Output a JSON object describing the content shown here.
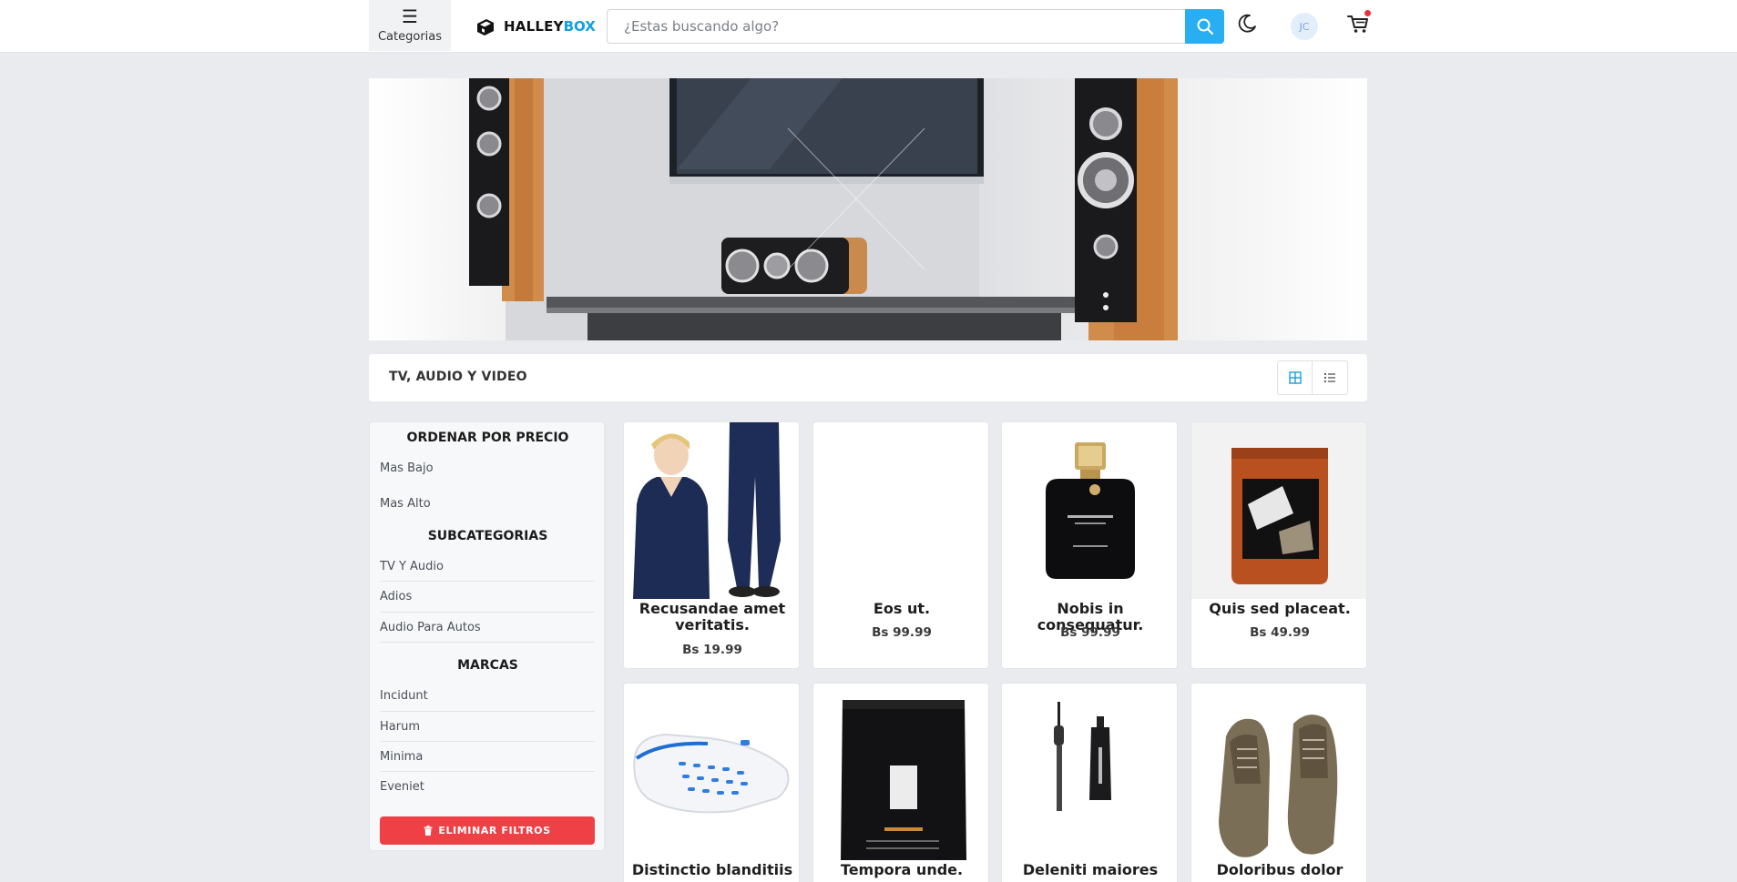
{
  "header": {
    "categories_label": "Categorias",
    "logo_part1": "HALLEY",
    "logo_part2": "BOX",
    "search_placeholder": "¿Estas buscando algo?",
    "avatar_initials": "JC",
    "accent_color": "#29aef2",
    "cart_badge_color": "#ee2f3b"
  },
  "page": {
    "section_title": "TV, AUDIO Y VIDEO",
    "view_modes": [
      "grid",
      "list"
    ],
    "active_view": "grid"
  },
  "filters": {
    "sort_heading": "ORDENAR POR PRECIO",
    "sort_options": [
      "Mas Bajo",
      "Mas Alto"
    ],
    "subcategories_heading": "SUBCATEGORIAS",
    "subcategories": [
      "TV Y Audio",
      "Adios",
      "Audio Para Autos"
    ],
    "brands_heading": "MARCAS",
    "brands": [
      "Incidunt",
      "Harum",
      "Minima",
      "Eveniet"
    ],
    "clear_label": "ELIMINAR FILTROS",
    "clear_color": "#ef4045"
  },
  "products": [
    {
      "name": "Recusandae amet veritatis.",
      "price": "Bs 19.99",
      "image": "scrubs-uniform"
    },
    {
      "name": "Eos ut.",
      "price": "Bs 99.99",
      "image": "none"
    },
    {
      "name": "Nobis in consequatur.",
      "price": "Bs 99.99",
      "image": "perfume-bottle"
    },
    {
      "name": "Quis sed placeat.",
      "price": "Bs 49.99",
      "image": "coffee-bag-orange"
    },
    {
      "name": "Distinctio blanditiis",
      "price": "",
      "image": "white-clog"
    },
    {
      "name": "Tempora unde.",
      "price": "",
      "image": "coffee-bag-black"
    },
    {
      "name": "Deleniti maiores",
      "price": "",
      "image": "mascara"
    },
    {
      "name": "Doloribus dolor",
      "price": "",
      "image": "suede-shoes"
    }
  ]
}
